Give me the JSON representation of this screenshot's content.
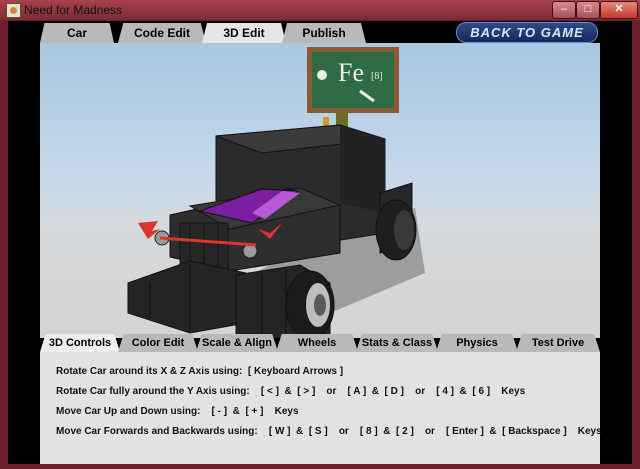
{
  "window": {
    "title": "Need for Madness",
    "controls": {
      "minimize": "‒",
      "maximize": "□",
      "close": "✕"
    }
  },
  "top_tabs": [
    {
      "label": "Car",
      "active": false
    },
    {
      "label": "Code Edit",
      "active": false
    },
    {
      "label": "3D Edit",
      "active": true
    },
    {
      "label": "Publish",
      "active": false
    }
  ],
  "back_button": "BACK TO GAME",
  "bottom_tabs": [
    {
      "label": "3D Controls",
      "active": true
    },
    {
      "label": "Color Edit",
      "active": false
    },
    {
      "label": "Scale & Align",
      "active": false
    },
    {
      "label": "Wheels",
      "active": false
    },
    {
      "label": "Stats & Class",
      "active": false
    },
    {
      "label": "Physics",
      "active": false
    },
    {
      "label": "Test Drive",
      "active": false
    }
  ],
  "controls_text": [
    "Rotate Car around its X & Z Axis using:  [ Keyboard Arrows ]",
    "Rotate Car fully around the Y Axis using:    [ < ]  &  [ > ]    or    [ A ]  &  [ D ]    or    [ 4 ]  &  [ 6 ]    Keys",
    "Move Car Up and Down using:    [ - ]  &  [ + ]    Keys",
    "Move Car Forwards and Backwards using:    [ W ]  &  [ S ]    or    [ 8 ]  &  [ 2 ]    or    [ Enter ]  &  [ Backspace ]    Keys"
  ],
  "chalkboard_text": "Fe",
  "chalkboard_subscript": "[8]",
  "colors": {
    "title_bar": "#9b3a46",
    "car_body": "#2b2b2b",
    "windshield": "#7a1fa0",
    "accent_red": "#d6382a",
    "chalkboard": "#2f6b45"
  }
}
